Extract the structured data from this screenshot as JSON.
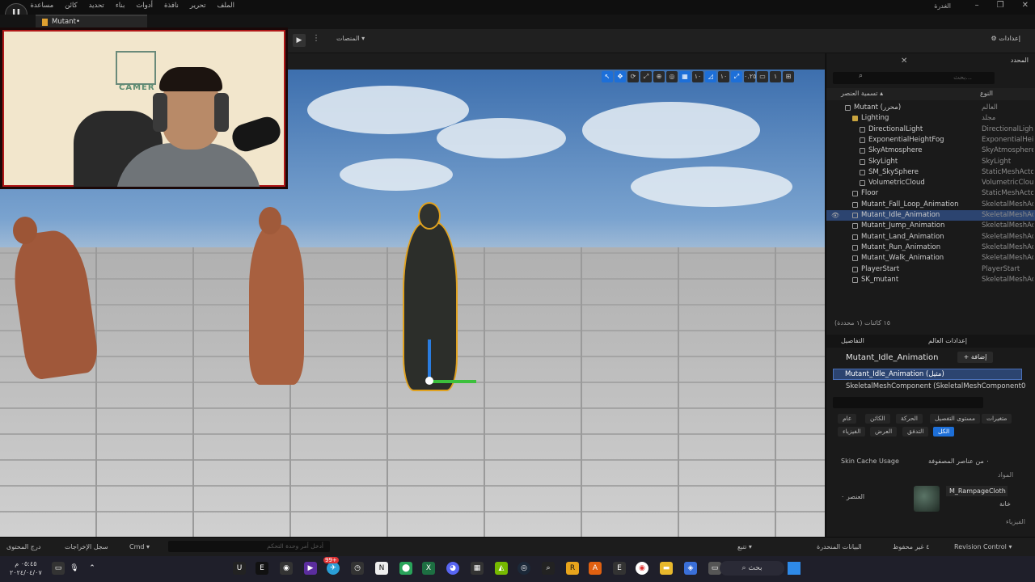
{
  "titlebar": {
    "menu": [
      "الملف",
      "تحرير",
      "نافذة",
      "أدوات",
      "بناء",
      "تحديد",
      "كائن",
      "مساعدة"
    ],
    "window_title": "الغدرة",
    "controls": [
      "–",
      "❐",
      "✕"
    ],
    "logo": "U"
  },
  "document_tab": "Mutant•",
  "toolbar": {
    "platforms": "المنصات ▾",
    "settings": "⚙ إعدادات"
  },
  "webcam": {
    "sign_text": "CAMER"
  },
  "viewport": {
    "tools": [
      "↖",
      "✥",
      "⟳",
      "⤢",
      "⊕",
      "◎",
      "▦",
      "١٠",
      "◿",
      "١٠",
      "⤢",
      "٠.٢٥",
      "▭",
      "١",
      "⊞"
    ]
  },
  "outliner": {
    "tab": "المحدد",
    "search_placeholder": "بحث...",
    "col_label": "تسمية العنصر ▴",
    "col_type": "النوع",
    "rows": [
      {
        "name": "Mutant (محرر)",
        "type": "العالم",
        "indent": 1,
        "icon": "level"
      },
      {
        "name": "Lighting",
        "type": "مجلد",
        "indent": 2,
        "icon": "folder"
      },
      {
        "name": "DirectionalLight",
        "type": "DirectionalLight",
        "indent": 3,
        "icon": "actor"
      },
      {
        "name": "ExponentialHeightFog",
        "type": "ExponentialHeigh",
        "indent": 3,
        "icon": "actor"
      },
      {
        "name": "SkyAtmosphere",
        "type": "SkyAtmosphere",
        "indent": 3,
        "icon": "actor"
      },
      {
        "name": "SkyLight",
        "type": "SkyLight",
        "indent": 3,
        "icon": "actor"
      },
      {
        "name": "SM_SkySphere",
        "type": "StaticMeshActor",
        "indent": 3,
        "icon": "actor"
      },
      {
        "name": "VolumetricCloud",
        "type": "VolumetricCloud",
        "indent": 3,
        "icon": "actor"
      },
      {
        "name": "Floor",
        "type": "StaticMeshActor",
        "indent": 2,
        "icon": "actor"
      },
      {
        "name": "Mutant_Fall_Loop_Animation",
        "type": "SkeletalMeshAc",
        "indent": 2,
        "icon": "actor"
      },
      {
        "name": "Mutant_Idle_Animation",
        "type": "SkeletalMeshAc",
        "indent": 2,
        "icon": "actor",
        "selected": true
      },
      {
        "name": "Mutant_Jump_Animation",
        "type": "SkeletalMeshAc",
        "indent": 2,
        "icon": "actor"
      },
      {
        "name": "Mutant_Land_Animation",
        "type": "SkeletalMeshAc",
        "indent": 2,
        "icon": "actor"
      },
      {
        "name": "Mutant_Run_Animation",
        "type": "SkeletalMeshAc",
        "indent": 2,
        "icon": "actor"
      },
      {
        "name": "Mutant_Walk_Animation",
        "type": "SkeletalMeshAc",
        "indent": 2,
        "icon": "actor"
      },
      {
        "name": "PlayerStart",
        "type": "PlayerStart",
        "indent": 2,
        "icon": "actor"
      },
      {
        "name": "SK_mutant",
        "type": "SkeletalMeshAc",
        "indent": 2,
        "icon": "actor"
      }
    ],
    "actor_count": "١٥ كائنات (١ محددة)"
  },
  "details": {
    "tab_details": "التفاصيل",
    "tab_world": "إعدادات العالم",
    "title": "Mutant_Idle_Animation",
    "add_label": "+ إضافة",
    "component_selected": "Mutant_Idle_Animation (مثيل)",
    "component_child": "SkeletalMeshComponent (SkeletalMeshComponent0",
    "search_placeholder": "بحث",
    "filters_row1": [
      "متغيرات",
      "مستوى التفصيل",
      "الحركة",
      "الكائن",
      "عام"
    ],
    "filters_row2": [
      "الكل",
      "التدفق",
      "العرض",
      "الفيزياء"
    ],
    "skin_cache": "Skin Cache Usage",
    "array_elems": "٠ من عناصر المصفوفة",
    "section_materials": "المواد",
    "element_label": "العنصر ٠",
    "material_name": "M_RampageCloth",
    "slot_label": "خانة",
    "section_physics": "الفيزياء"
  },
  "statusbar": {
    "content_drawer": "درج المحتوى",
    "output_log": "سجل الإخراجات",
    "cmd": "Cmd ▾",
    "cmd_placeholder": "أدخل أمر وحدة التحكم",
    "trace": "تتبع ▾",
    "derived_data": "البيانات المنحدرة",
    "unsaved": "٤ غير محفوظ",
    "revision_control": "Revision Control ▾"
  },
  "taskbar": {
    "clock_time": "٠٥:٤٥ م",
    "clock_date": "٢٠٢٤/٠٤/٠٧",
    "search": "⌕ بحث",
    "badge": "99+"
  }
}
